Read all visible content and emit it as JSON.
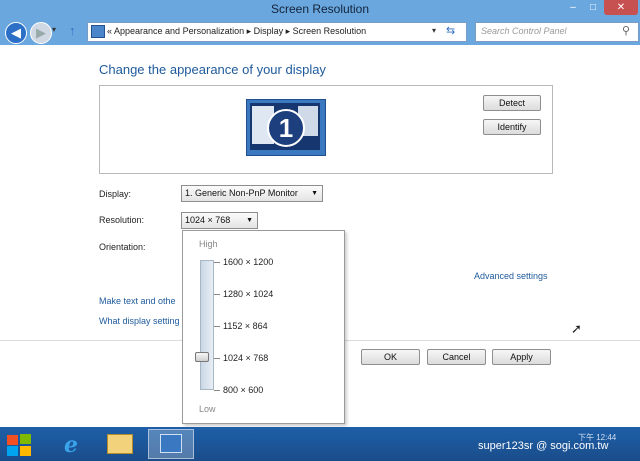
{
  "window": {
    "title": "Screen Resolution",
    "min": "–",
    "max": "□",
    "close": "✕"
  },
  "nav": {
    "back": "◀",
    "forward": "▶",
    "recent": "▾",
    "up": "↑",
    "breadcrumb": "«  Appearance and Personalization  ▸  Display  ▸  Screen Resolution",
    "address_drop": "▾",
    "refresh": "⇆",
    "search_placeholder": "Search Control Panel",
    "search_glyph": "⚲"
  },
  "main": {
    "heading": "Change the appearance of your display",
    "monitor_number": "1",
    "detect": "Detect",
    "identify": "Identify",
    "display_label": "Display:",
    "display_value": "1. Generic Non-PnP Monitor",
    "resolution_label": "Resolution:",
    "resolution_value": "1024 × 768",
    "orientation_label": "Orientation:",
    "advanced_link": "Advanced settings",
    "make_text_link": "Make text and othe",
    "what_display_link": "What display setting",
    "ok": "OK",
    "cancel": "Cancel",
    "apply": "Apply",
    "dropdown_arrow": "▼"
  },
  "resolution_popup": {
    "high": "High",
    "low": "Low",
    "options": [
      "1600 × 1200",
      "1280 × 1024",
      "1152 × 864",
      "1024 × 768",
      "800 × 600"
    ],
    "selected": "1024 × 768",
    "selected_index": 3
  },
  "taskbar": {
    "ie_glyph": "e",
    "watermark": "super123sr  @ sogi.com.tw",
    "clock": "下午 12:44"
  },
  "colors": {
    "accent": "#6aa7de",
    "link": "#1e5a9c",
    "taskbar": "#1e5fa8"
  }
}
